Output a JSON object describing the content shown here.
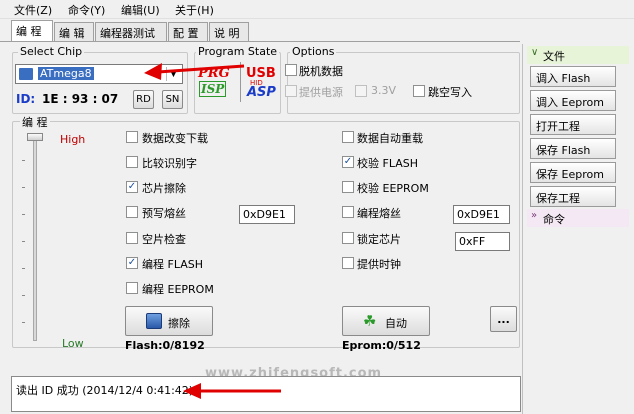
{
  "menu": [
    "文件(Z)",
    "命令(Y)",
    "编辑(U)",
    "关于(H)"
  ],
  "tabs": [
    "编 程",
    "编 辑",
    "编程器测试",
    "配 置",
    "说 明"
  ],
  "select_chip": {
    "title": "Select Chip",
    "chip": "ATmega8",
    "id_label": "ID:",
    "id_value": "1E : 93 : 07",
    "rd": "RD",
    "sn": "SN"
  },
  "program_state": {
    "title": "Program State",
    "prg": "PRG",
    "isp": "ISP",
    "usb": "USB",
    "hid": "HID",
    "asp": "ASP"
  },
  "options": {
    "title": "Options",
    "items": [
      {
        "label": "脱机数据",
        "checked": false,
        "disabled": false
      },
      {
        "label": "提供电源",
        "checked": false,
        "disabled": true
      },
      {
        "label": "3.3V",
        "checked": false,
        "disabled": true
      },
      {
        "label": "跳空写入",
        "checked": false,
        "disabled": false
      }
    ]
  },
  "program": {
    "title": "编 程",
    "high": "High",
    "low": "Low",
    "left_checks": [
      {
        "label": "数据改变下载",
        "checked": false
      },
      {
        "label": "比较识别字",
        "checked": false
      },
      {
        "label": "芯片擦除",
        "checked": true
      },
      {
        "label": "预写熔丝",
        "checked": false
      },
      {
        "label": "空片检查",
        "checked": false
      },
      {
        "label": "编程 FLASH",
        "checked": true
      },
      {
        "label": "编程 EEPROM",
        "checked": false
      }
    ],
    "right_checks": [
      {
        "label": "数据自动重载",
        "checked": false
      },
      {
        "label": "校验 FLASH",
        "checked": true
      },
      {
        "label": "校验 EEPROM",
        "checked": false
      },
      {
        "label": "编程熔丝",
        "checked": false
      },
      {
        "label": "锁定芯片",
        "checked": false
      },
      {
        "label": "提供时钟",
        "checked": false
      }
    ],
    "fuse_left": "0xD9E1",
    "fuse_right": "0xD9E1",
    "lock": "0xFF",
    "erase_btn": "擦除",
    "auto_btn": "自动",
    "more_btn": "...",
    "flash_info": "Flash:0/8192",
    "eprom_info": "Eprom:0/512"
  },
  "log": {
    "line": "读出 ID 成功 (2014/12/4 0:41:42)",
    "watermark": "www.zhifengsoft.com"
  },
  "side": {
    "file_header": "文件",
    "buttons": [
      "调入 Flash",
      "调入 Eeprom",
      "打开工程",
      "保存 Flash",
      "保存 Eeprom",
      "保存工程"
    ],
    "cmd_header": "命令"
  },
  "colors": {
    "accent": "#3a6ec0",
    "red": "#e00000",
    "side_header": "#e8f4d8"
  }
}
